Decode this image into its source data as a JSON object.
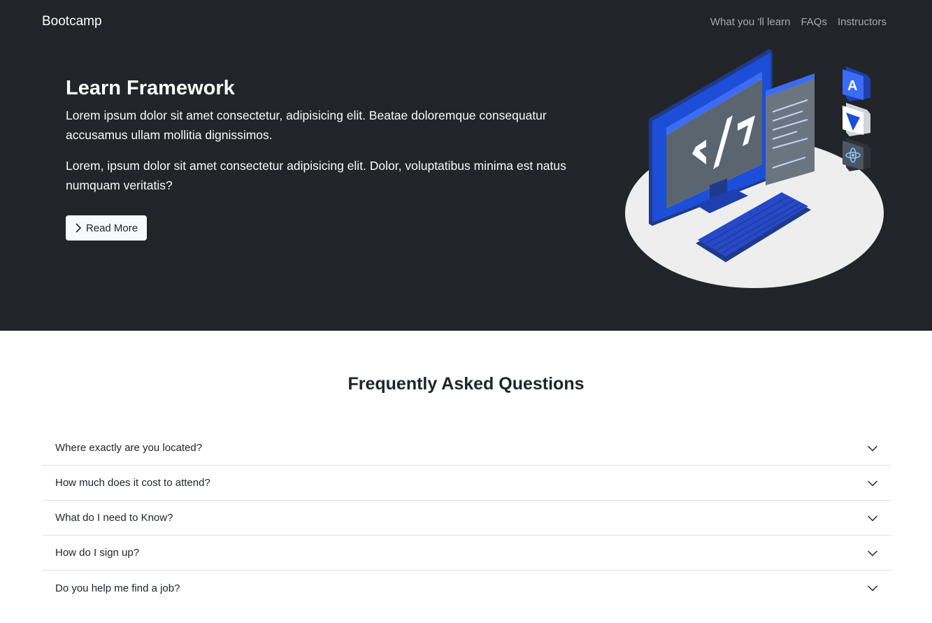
{
  "navbar": {
    "brand": "Bootcamp",
    "links": [
      "What you 'll learn",
      "FAQs",
      "Instructors"
    ]
  },
  "hero": {
    "title": "Learn Framework",
    "paragraph1": "Lorem ipsum dolor sit amet consectetur, adipisicing elit. Beatae doloremque consequatur accusamus ullam mollitia dignissimos.",
    "paragraph2": "Lorem, ipsum dolor sit amet consectetur adipisicing elit. Dolor, voluptatibus minima est natus numquam veritatis?",
    "button_label": "Read More"
  },
  "faq": {
    "title": "Frequently Asked Questions",
    "items": [
      "Where exactly are you located?",
      "How much does it cost to attend?",
      "What do I need to Know?",
      "How do I sign up?",
      "Do you help me find a job?"
    ]
  },
  "icons": {
    "button": "chevron-right-icon",
    "faq_toggle": "chevron-down-icon",
    "illustration": "computer-code-illustration"
  },
  "colors": {
    "hero_bg": "#212529",
    "accent": "#1e40af",
    "accent_light": "#3b6cf6"
  }
}
